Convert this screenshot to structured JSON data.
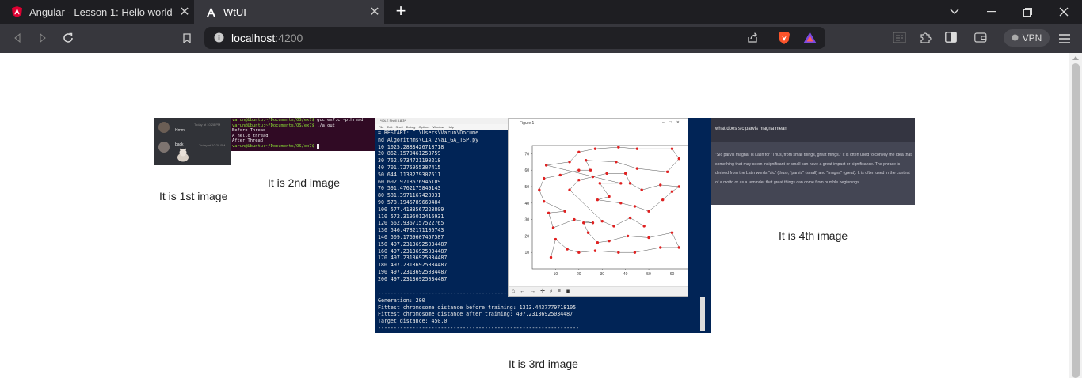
{
  "browser": {
    "tabs": [
      {
        "title": "Angular - Lesson 1: Hello world",
        "active": false,
        "icon": "angular-icon"
      },
      {
        "title": "WtUI",
        "active": true,
        "icon": "angular-a-icon"
      }
    ],
    "address": {
      "host": "localhost",
      "port": ":4200"
    },
    "vpn_label": "VPN"
  },
  "captions": {
    "img1": "It is 1st image",
    "img2": "It is 2nd image",
    "img3": "It is 3rd image",
    "img4": "It is 4th image"
  },
  "image1": {
    "msg1_user": "",
    "msg1_time": "Today at 10:28 PM",
    "msg1_text": "Hmm",
    "msg2_user": "back",
    "msg2_time": "Today at 10:28 PM"
  },
  "image2": {
    "prompt1": "varun@Ubuntu:~/Documents/OS/ex7$",
    "cmd1": " gcc ex7.c -pthread",
    "prompt2": "varun@Ubuntu:~/Documents/OS/ex7$",
    "cmd2": " ./a.out",
    "out1": "Before Thread",
    "out2": "A hello thread",
    "out3": "After Thread",
    "prompt3": "varun@Ubuntu:~/Documents/OS/ex7$"
  },
  "image3": {
    "shell_title": "*IDLE Shell 3.8.3*",
    "shell_menu": "File Edit Shell Debug Options Window Help",
    "restart_line": "= RESTART: C:\\Users\\Varun\\Docume\nnd Algorithms\\CIA 2\\a1_GA_TSP.py",
    "rows": [
      "10 1025.2883426718718",
      "20 862.1570461258759",
      "30 762.9734721190218",
      "40 701.7275955307415",
      "50 644.1133279307611",
      "60 602.9718676945109",
      "70 591.4762175849143",
      "80 581.3971167428931",
      "90 578.1945789669484",
      "100 577.4183567228809",
      "110 572.3196012416931",
      "120 562.9367157522765",
      "130 546.4782171106743",
      "140 509.1769607457587",
      "150 497.23136925034487",
      "160 497.23136925034487",
      "170 497.23136925034487",
      "180 497.23136925034487",
      "190 497.23136925034487",
      "200 497.23136925034487"
    ],
    "generation": "Generation: 200",
    "before": "Fittest chromosome distance before training: 1313.4437779718105",
    "after": "Fittest chromosome distance after training: 497.23136925034487",
    "target": "Target distance: 450.0",
    "figure_title": "Figure 1",
    "figure_tools": "⌂ ← → ✛ ⌕ ≡ ▣"
  },
  "image4": {
    "question": "what does sic parvis magna mean",
    "answer": "\"Sic parvis magna\" is Latin for \"Thus, from small things, great things.\" It is often used to convey the idea that something that may seem insignificant or small can have a great impact or significance. The phrase is derived from the Latin words \"sic\" (thus), \"parvis\" (small) and \"magna\" (great). It is often used in the context of a motto or as a reminder that great things can come from humble beginnings."
  },
  "chart_data": {
    "type": "scatter",
    "title": "",
    "xlabel": "",
    "ylabel": "",
    "xlim": [
      0,
      68
    ],
    "ylim": [
      0,
      75
    ],
    "xticks": [
      10,
      20,
      30,
      40,
      50,
      60
    ],
    "yticks": [
      10,
      20,
      30,
      40,
      50,
      60,
      70
    ],
    "points": [
      [
        8,
        7
      ],
      [
        10,
        18
      ],
      [
        15,
        12
      ],
      [
        20,
        10
      ],
      [
        27,
        11
      ],
      [
        37,
        10
      ],
      [
        44,
        10
      ],
      [
        55,
        13
      ],
      [
        63,
        13
      ],
      [
        60,
        22
      ],
      [
        50,
        19
      ],
      [
        41,
        20
      ],
      [
        33,
        17
      ],
      [
        28,
        16
      ],
      [
        24,
        22
      ],
      [
        22,
        28
      ],
      [
        26,
        28
      ],
      [
        18,
        30
      ],
      [
        9,
        25
      ],
      [
        7,
        34
      ],
      [
        14,
        35
      ],
      [
        5,
        41
      ],
      [
        3,
        48
      ],
      [
        5,
        55
      ],
      [
        12,
        57
      ],
      [
        20,
        60
      ],
      [
        25,
        60
      ],
      [
        23,
        66
      ],
      [
        36,
        65
      ],
      [
        45,
        61
      ],
      [
        58,
        59
      ],
      [
        63,
        67
      ],
      [
        60,
        73
      ],
      [
        45,
        73
      ],
      [
        37,
        74
      ],
      [
        27,
        73
      ],
      [
        20,
        71
      ],
      [
        16,
        65
      ],
      [
        6,
        63
      ],
      [
        38,
        52
      ],
      [
        29,
        52
      ],
      [
        33,
        44
      ],
      [
        28,
        42
      ],
      [
        38,
        40
      ],
      [
        44,
        38
      ],
      [
        50,
        35
      ],
      [
        56,
        42
      ],
      [
        60,
        47
      ],
      [
        63,
        50
      ],
      [
        55,
        51
      ],
      [
        47,
        48
      ],
      [
        42,
        52
      ],
      [
        40,
        58
      ],
      [
        32,
        58
      ],
      [
        26,
        56
      ],
      [
        20,
        54
      ],
      [
        16,
        48
      ],
      [
        30,
        29
      ],
      [
        35,
        26
      ],
      [
        42,
        31
      ],
      [
        48,
        26
      ]
    ],
    "route_color": "#555555",
    "point_color": "#e02020"
  },
  "colors": {
    "tab_bg": "#1e1e22",
    "toolbar_bg": "#37373d",
    "angular_red": "#dd0031",
    "brave_orange": "#fb542b"
  }
}
